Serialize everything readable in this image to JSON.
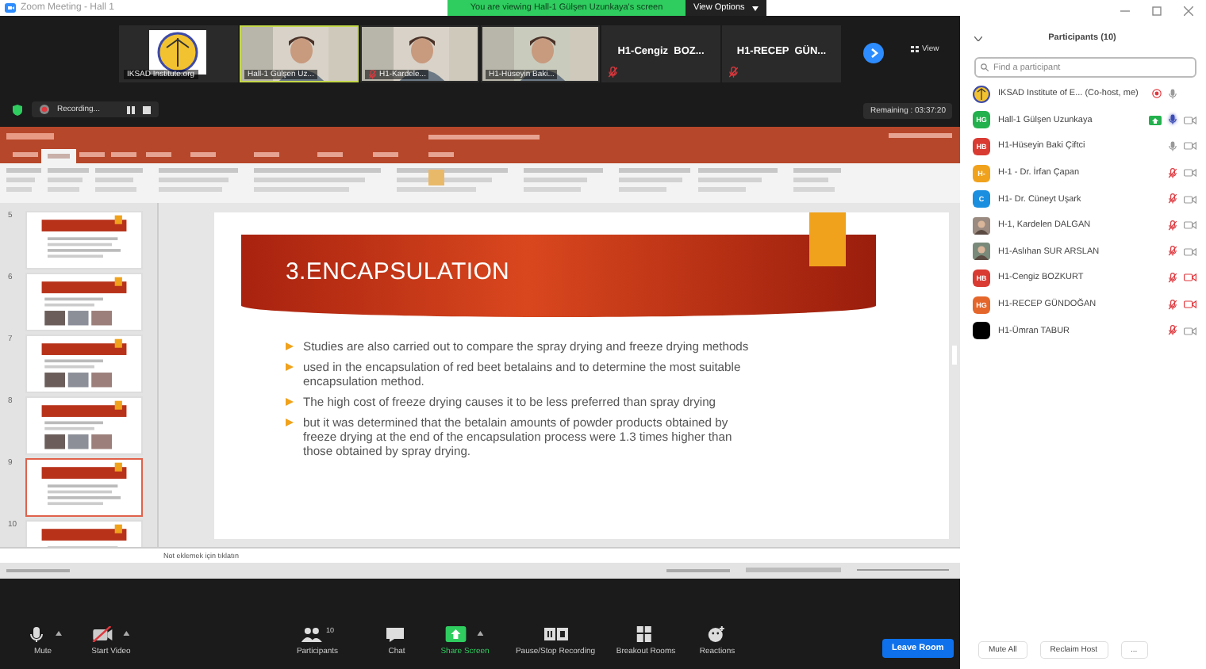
{
  "window": {
    "title": "Zoom Meeting - Hall 1"
  },
  "share_banner": {
    "text": "You are viewing Hall-1 Gülşen Uzunkaya's screen",
    "options": "View Options"
  },
  "video_strip": {
    "view_label": "View",
    "tiles": [
      {
        "kind": "logo",
        "name": "IKSAD Institute.org",
        "muted": false,
        "speaking": false
      },
      {
        "kind": "video",
        "name": "Hall-1 Gülşen Uz...",
        "muted": false,
        "speaking": true
      },
      {
        "kind": "video",
        "name": "H1-Kardele...",
        "muted": true,
        "speaking": false
      },
      {
        "kind": "video",
        "name": "H1-Hüseyin Baki...",
        "muted": false,
        "speaking": false
      },
      {
        "kind": "name",
        "name": "H1-Cengiz  BOZ...",
        "muted": true,
        "speaking": false
      },
      {
        "kind": "name",
        "name": "H1-RECEP  GÜN...",
        "muted": true,
        "speaking": false
      }
    ]
  },
  "recording": {
    "label": "Recording..."
  },
  "remaining": "Remaining : 03:37:20",
  "presentation": {
    "thumbnails": [
      {
        "number": "5",
        "kind": "text",
        "selected": false
      },
      {
        "number": "6",
        "kind": "photos",
        "selected": false
      },
      {
        "number": "7",
        "kind": "photos",
        "selected": false
      },
      {
        "number": "8",
        "kind": "photos",
        "selected": false
      },
      {
        "number": "9",
        "kind": "text",
        "selected": true
      },
      {
        "number": "10",
        "kind": "text",
        "selected": false
      }
    ],
    "slide": {
      "title": "3.ENCAPSULATION",
      "bullets": [
        "Studies are also carried out to compare the spray drying and freeze drying methods",
        "used in the encapsulation of red beet betalains and to determine the most suitable encapsulation method.",
        "The high cost of freeze drying causes it to be less preferred than spray drying",
        "but it was determined that the betalain amounts of powder products obtained by freeze drying at the end of the encapsulation process were 1.3 times higher than those obtained by spray drying."
      ]
    },
    "notes_placeholder": "Not eklemek için tıklatın"
  },
  "toolbar": [
    {
      "kind": "mic",
      "label": "Mute",
      "menu": true,
      "accent": false
    },
    {
      "kind": "video-off",
      "label": "Start Video",
      "menu": true,
      "accent": false
    },
    {
      "kind": "participants",
      "label": "Participants",
      "badge": "10",
      "menu": false,
      "accent": false
    },
    {
      "kind": "chat",
      "label": "Chat",
      "menu": false,
      "accent": false
    },
    {
      "kind": "share",
      "label": "Share Screen",
      "menu": true,
      "accent": true
    },
    {
      "kind": "record",
      "label": "Pause/Stop Recording",
      "menu": false,
      "accent": false
    },
    {
      "kind": "rooms",
      "label": "Breakout Rooms",
      "menu": false,
      "accent": false
    },
    {
      "kind": "reactions",
      "label": "Reactions",
      "menu": false,
      "accent": false
    }
  ],
  "leave_button": "Leave Room",
  "participants": {
    "title": "Participants (10)",
    "search_placeholder": "Find a participant",
    "items": [
      {
        "name": "IKSAD Institute of E... (Co-host, me)",
        "avatar": {
          "kind": "logo"
        },
        "recording": true,
        "sharing": false,
        "muted": false,
        "talking": false,
        "camera": false,
        "camera_blocked": false
      },
      {
        "name": "Hall-1 Gülşen Uzunkaya",
        "avatar": {
          "kind": "initials",
          "text": "HG",
          "color": "#23b14d"
        },
        "recording": false,
        "sharing": true,
        "muted": false,
        "talking": true,
        "camera": true,
        "camera_blocked": false
      },
      {
        "name": "H1-Hüseyin Baki Çiftci",
        "avatar": {
          "kind": "initials",
          "text": "HB",
          "color": "#d93a32"
        },
        "recording": false,
        "sharing": false,
        "muted": false,
        "talking": false,
        "camera": true,
        "camera_blocked": false
      },
      {
        "name": "H-1 - Dr. İrfan Çapan",
        "avatar": {
          "kind": "initials",
          "text": "H-",
          "color": "#f0a21c"
        },
        "recording": false,
        "sharing": false,
        "muted": true,
        "talking": false,
        "camera": true,
        "camera_blocked": false
      },
      {
        "name": "H1- Dr. Cüneyt Uşark",
        "avatar": {
          "kind": "initials",
          "text": "C",
          "color": "#1a8fe0"
        },
        "recording": false,
        "sharing": false,
        "muted": true,
        "talking": false,
        "camera": true,
        "camera_blocked": false
      },
      {
        "name": "H-1, Kardelen DALGAN",
        "recording": false,
        "sharing": false,
        "muted": true,
        "talking": false,
        "camera": true,
        "camera_blocked": false
      },
      {
        "name": "H1-Aslıhan SUR ARSLAN",
        "recording": false,
        "sharing": false,
        "muted": true,
        "talking": false,
        "camera": true,
        "camera_blocked": false
      },
      {
        "name": "H1-Cengiz BOZKURT",
        "avatar": {
          "kind": "initials",
          "text": "HB",
          "color": "#d93a32"
        },
        "recording": false,
        "sharing": false,
        "muted": true,
        "talking": false,
        "camera": true,
        "camera_blocked": true
      },
      {
        "name": "H1-RECEP GÜNDOĞAN",
        "avatar": {
          "kind": "initials",
          "text": "HG",
          "color": "#e5662a"
        },
        "recording": false,
        "sharing": false,
        "muted": true,
        "talking": false,
        "camera": true,
        "camera_blocked": true
      },
      {
        "name": "H1-Ümran TABUR",
        "avatar": {
          "kind": "blank",
          "color": "#000000"
        },
        "recording": false,
        "sharing": false,
        "muted": true,
        "talking": false,
        "camera": true,
        "camera_blocked": false
      }
    ],
    "buttons": [
      "Mute All",
      "Reclaim Host"
    ],
    "more": "..."
  }
}
